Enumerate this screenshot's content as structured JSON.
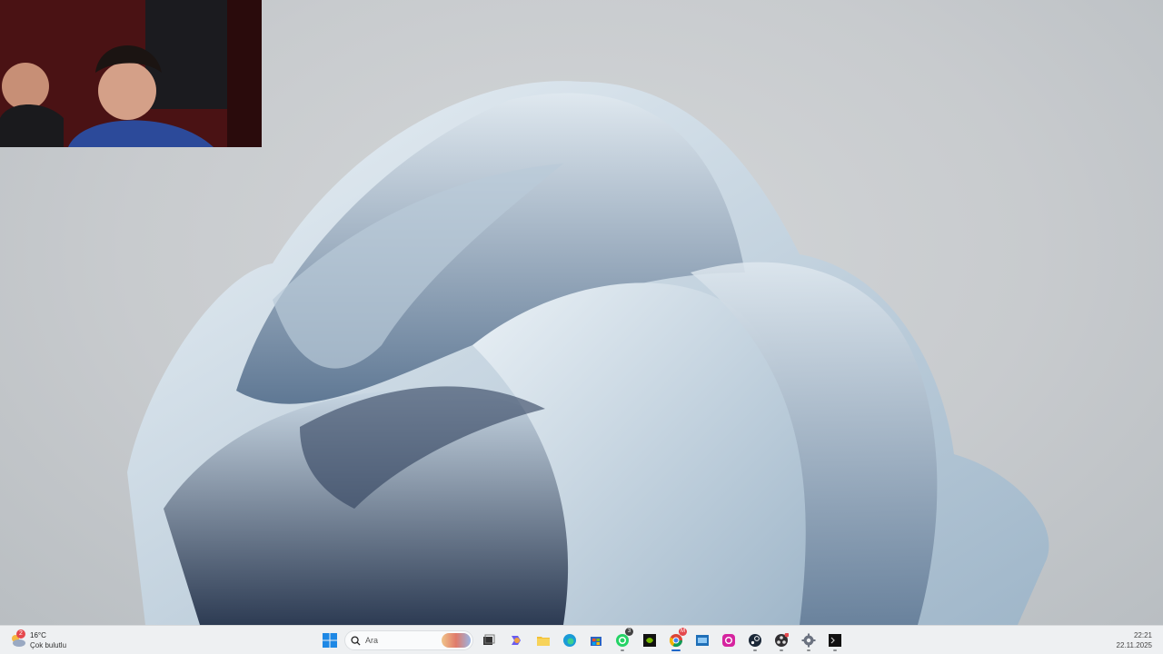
{
  "taskbar": {
    "weather": {
      "temperature": "16°C",
      "condition": "Çok bulutlu",
      "badge": "2",
      "icon": "cloud-sun-icon"
    },
    "search": {
      "placeholder": "Ara"
    },
    "badges": {
      "whatsapp": "3",
      "chrome": "M"
    },
    "clock": {
      "time": "22:21",
      "date": "22.11.2025"
    },
    "pinned": [
      "start",
      "search",
      "task-view",
      "copilot",
      "file-explorer",
      "edge",
      "microsoft-store",
      "whatsapp",
      "nvidia",
      "chrome",
      "desktop-app",
      "instagram",
      "steam",
      "obs",
      "settings",
      "terminal"
    ]
  },
  "colors": {
    "taskbar_bg": "#eef0f2",
    "accent": "#1e66c8"
  }
}
